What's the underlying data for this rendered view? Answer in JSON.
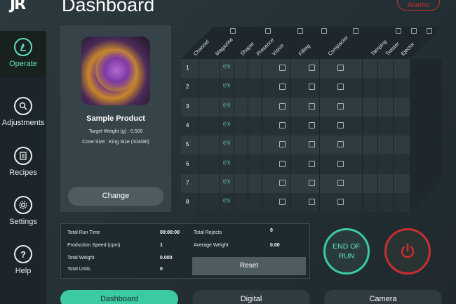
{
  "header": {
    "logo": "JR",
    "title": "Dashboard",
    "alarms_label": "Alarms"
  },
  "sidebar": {
    "items": [
      {
        "label": "Operate",
        "icon": "operate-icon",
        "active": true
      },
      {
        "label": "Adjustments",
        "icon": "adjustments-icon",
        "active": false
      },
      {
        "label": "Recipes",
        "icon": "recipes-icon",
        "active": false
      },
      {
        "label": "Settings",
        "icon": "gear-icon",
        "active": false
      },
      {
        "label": "Help",
        "icon": "help-icon",
        "active": false
      }
    ]
  },
  "product": {
    "name": "Sample Product",
    "target_weight": "Target Weight (g) : 0.500",
    "cone_size": "Cone Size : King Size (104/80)",
    "change_label": "Change"
  },
  "grid": {
    "columns": [
      "Channel",
      "Magazine",
      "Shaper",
      "Presence",
      "Vision",
      "Filling",
      "Compactor",
      "Tamping",
      "Twister",
      "Ejector"
    ],
    "rows": [
      "1",
      "2",
      "3",
      "4",
      "5",
      "6",
      "7",
      "8"
    ]
  },
  "stats": {
    "total_run_time_label": "Total Run Time",
    "total_run_time": "00:00:00",
    "production_speed_label": "Production Speed (cpm)",
    "production_speed": "1",
    "total_weight_label": "Total Weight",
    "total_weight": "0.000",
    "total_units_label": "Total Units",
    "total_units": "0",
    "total_rejects_label": "Total Rejects",
    "total_rejects": "0",
    "average_weight_label": "Average Weight",
    "average_weight": "0.00",
    "reset_label": "Reset"
  },
  "controls": {
    "end_of_run_line1": "END OF",
    "end_of_run_line2": "RUN"
  },
  "tabs": [
    {
      "label": "Dashboard",
      "active": true
    },
    {
      "label": "Digital",
      "active": false
    },
    {
      "label": "Camera",
      "active": false
    }
  ],
  "colors": {
    "accent": "#3ccaa5",
    "danger": "#c8302e",
    "background": "#243036"
  }
}
